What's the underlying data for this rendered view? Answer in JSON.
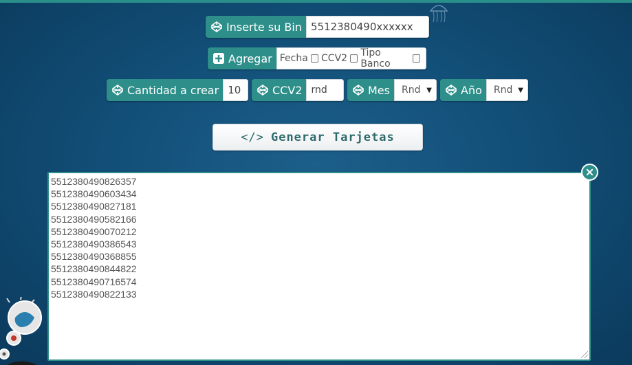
{
  "colors": {
    "accent": "#2e8f8a",
    "background": "#124f78"
  },
  "bin": {
    "label": "Inserte su Bin",
    "value": "5512380490xxxxxx",
    "icon": "codepen-icon"
  },
  "agregar": {
    "label": "Agregar",
    "icon": "plus-square-icon",
    "options": [
      {
        "label": "Fecha",
        "checked": false
      },
      {
        "label": "CCV2",
        "checked": false
      },
      {
        "label": "Tipo Banco",
        "checked": false
      }
    ]
  },
  "cantidad": {
    "label": "Cantidad a crear",
    "value": "10",
    "icon": "codepen-icon"
  },
  "ccv2": {
    "label": "CCV2",
    "value": "rnd",
    "icon": "codepen-icon"
  },
  "mes": {
    "label": "Mes",
    "selected": "Rnd",
    "icon": "codepen-icon"
  },
  "anio": {
    "label": "Año",
    "selected": "Rnd",
    "icon": "codepen-icon"
  },
  "generate_button": {
    "label": "Generar Tarjetas",
    "icon": "code-icon",
    "icon_text": "</>"
  },
  "output": {
    "lines": [
      "5512380490826357",
      "5512380490603434",
      "5512380490827181",
      "5512380490582166",
      "5512380490070212",
      "5512380490386543",
      "5512380490368855",
      "5512380490844822",
      "5512380490716574",
      "5512380490822133"
    ]
  }
}
